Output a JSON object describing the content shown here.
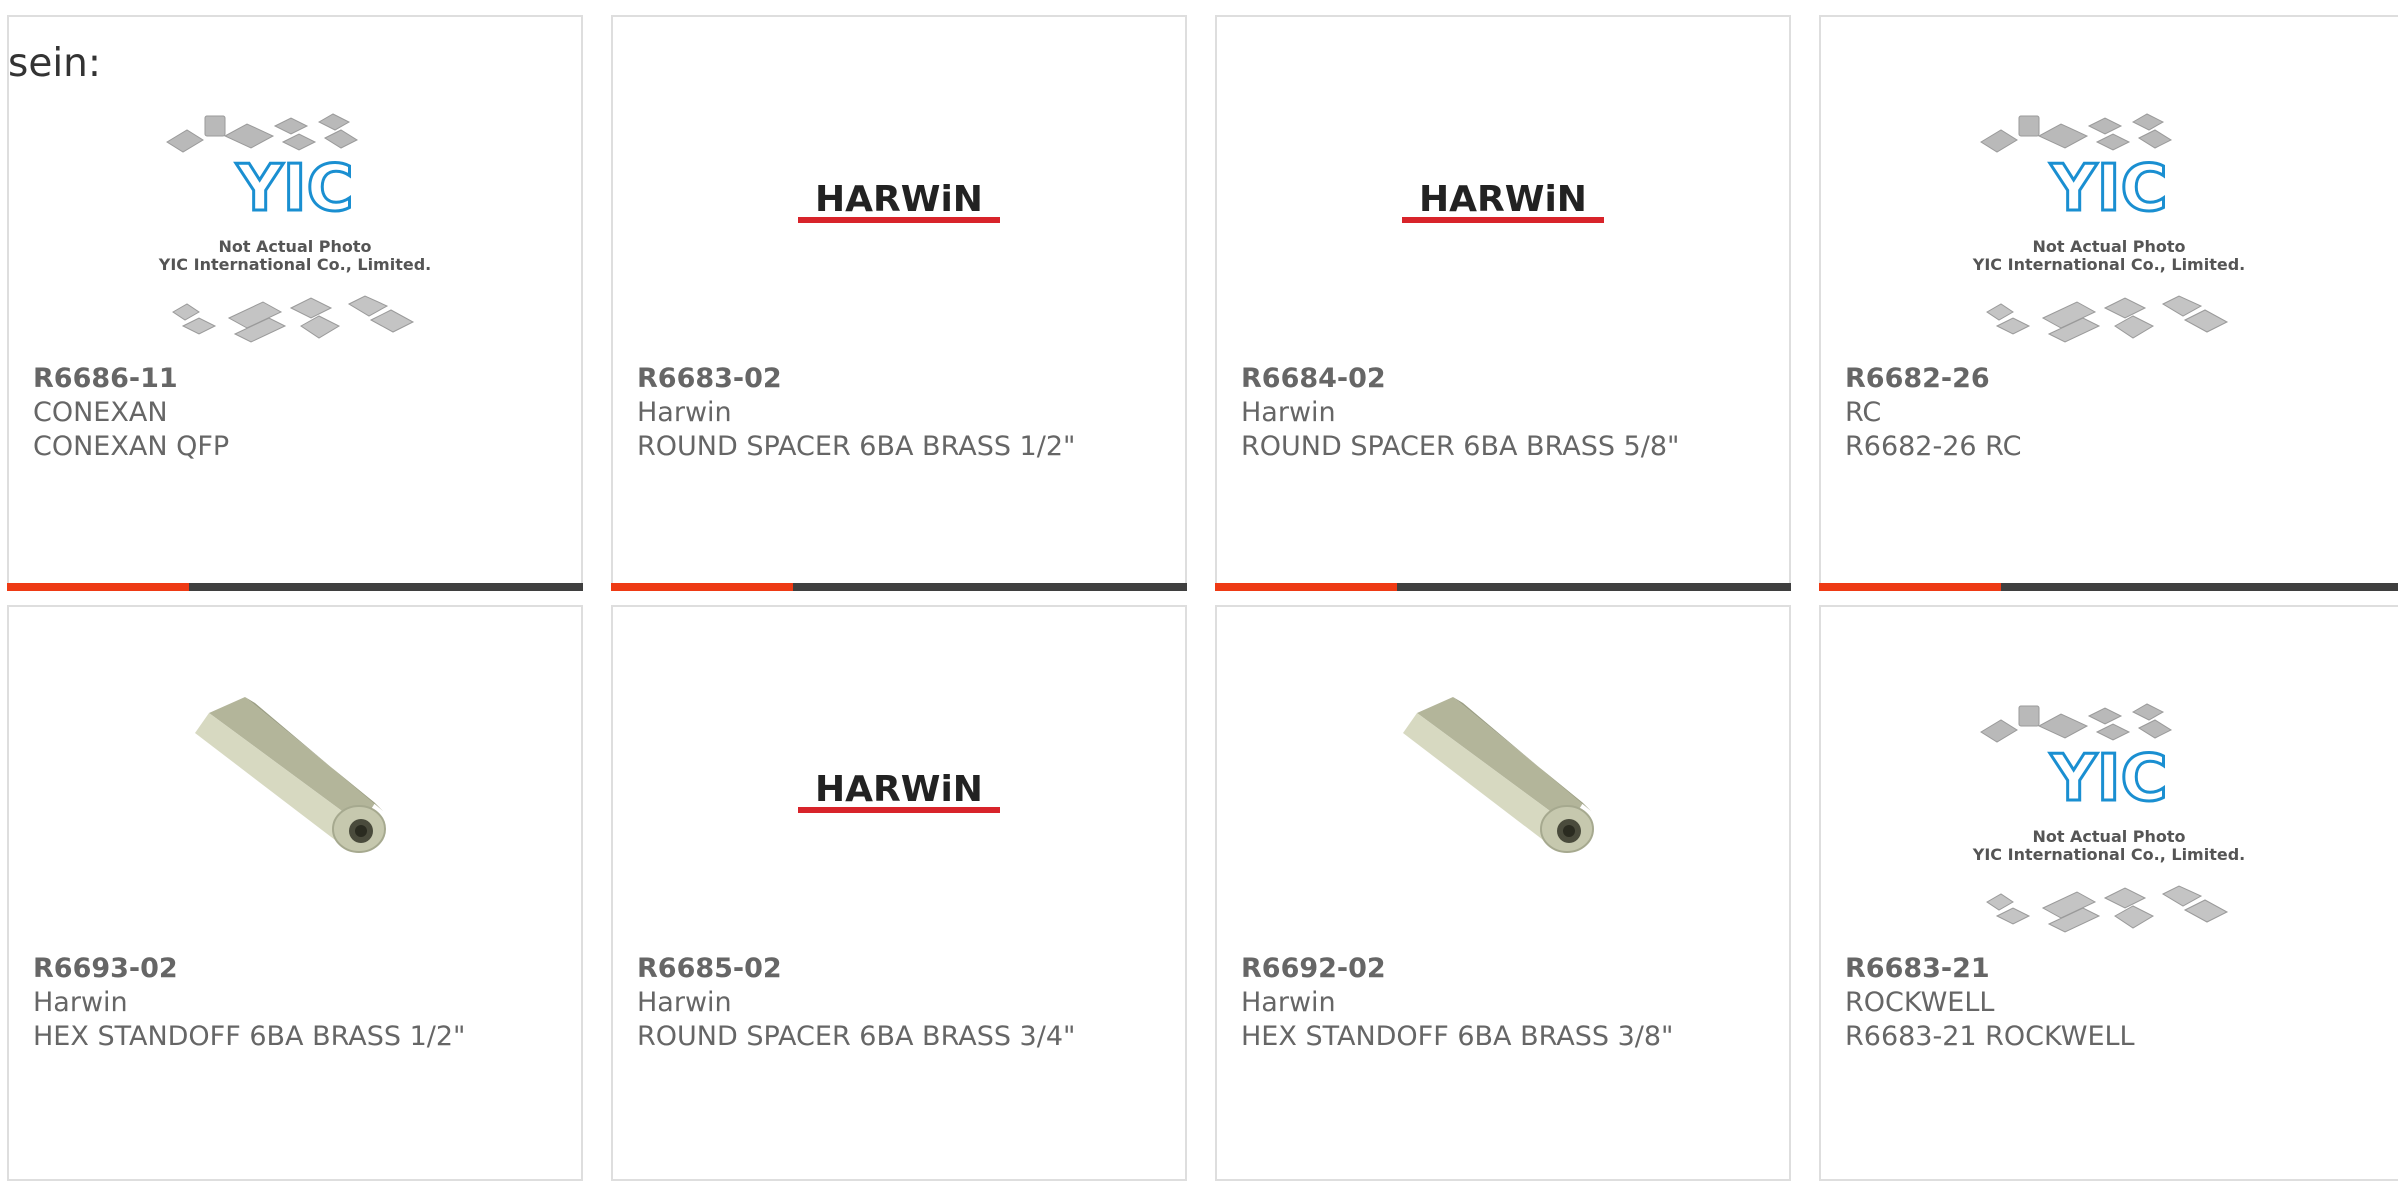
{
  "intro_text": "sein:",
  "colors": {
    "accent": "#ee3a14",
    "bar": "#3f3f3f",
    "text": "#666666",
    "harwin_red": "#d8232a",
    "yic_blue": "#1a8fd1"
  },
  "products": [
    {
      "part_no": "R6686-11",
      "brand": "CONEXAN",
      "description": "CONEXAN QFP",
      "image": "yic-placeholder"
    },
    {
      "part_no": "R6683-02",
      "brand": "Harwin",
      "description": "ROUND SPACER 6BA BRASS 1/2\"",
      "image": "harwin-logo"
    },
    {
      "part_no": "R6684-02",
      "brand": "Harwin",
      "description": "ROUND SPACER 6BA BRASS 5/8\"",
      "image": "harwin-logo"
    },
    {
      "part_no": "R6682-26",
      "brand": "RC",
      "description": "R6682-26 RC",
      "image": "yic-placeholder"
    },
    {
      "part_no": "R6693-02",
      "brand": "Harwin",
      "description": "HEX STANDOFF 6BA BRASS 1/2\"",
      "image": "hex-standoff"
    },
    {
      "part_no": "R6685-02",
      "brand": "Harwin",
      "description": "ROUND SPACER 6BA BRASS 3/4\"",
      "image": "harwin-logo"
    },
    {
      "part_no": "R6692-02",
      "brand": "Harwin",
      "description": "HEX STANDOFF 6BA BRASS 3/8\"",
      "image": "hex-standoff"
    },
    {
      "part_no": "R6683-21",
      "brand": "ROCKWELL",
      "description": "R6683-21 ROCKWELL",
      "image": "yic-placeholder"
    }
  ],
  "images": {
    "yic_placeholder": {
      "logo": "YIC",
      "line1": "Not Actual Photo",
      "line2": "YIC International Co., Limited."
    },
    "harwin_logo": {
      "text": "HARWiN"
    }
  }
}
